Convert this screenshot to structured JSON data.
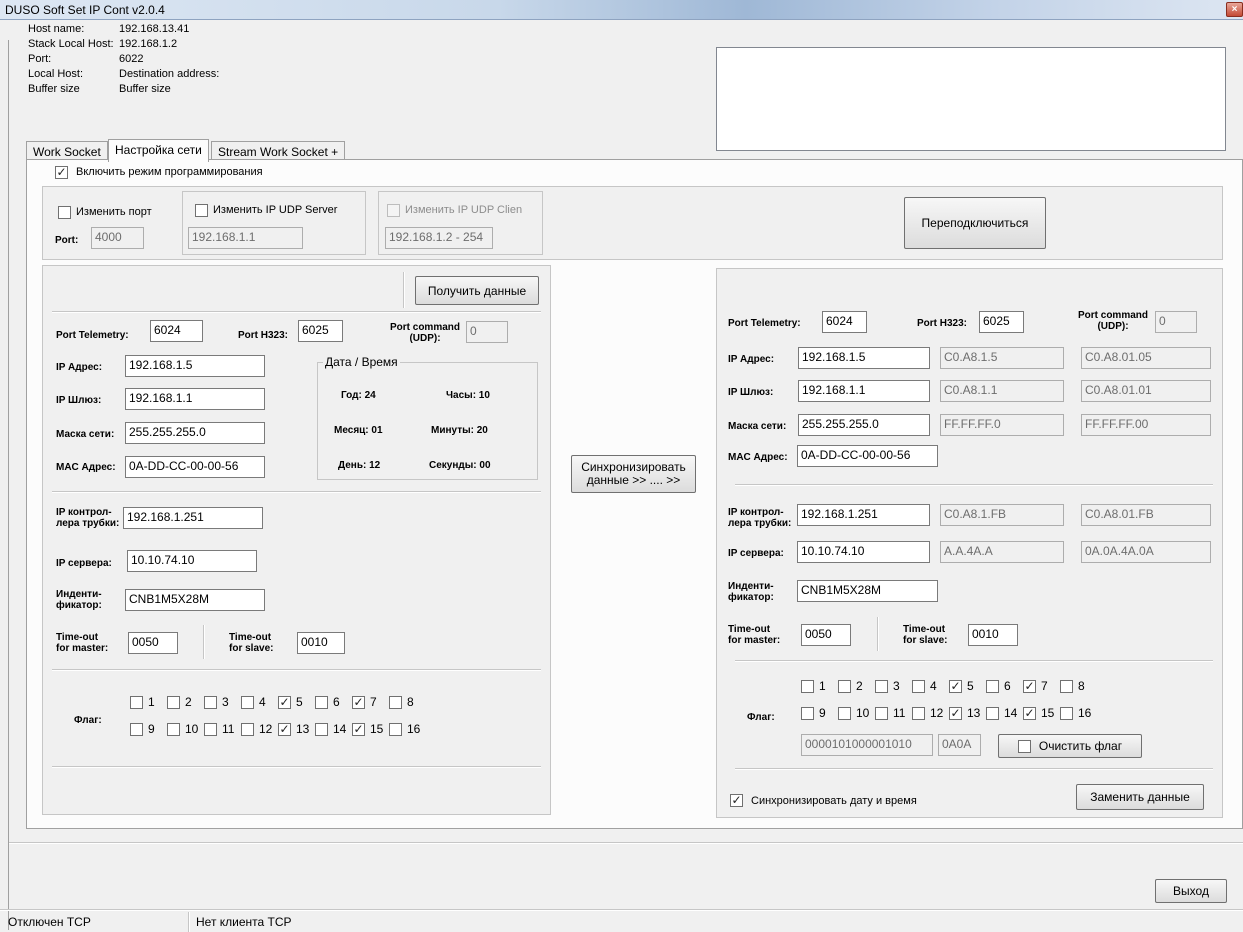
{
  "window": {
    "title": "DUSO Soft Set IP Cont v2.0.4",
    "close_glyph": "×"
  },
  "info": [
    {
      "label": "Host name:",
      "value": "192.168.13.41"
    },
    {
      "label": "Stack Local Host:",
      "value": "192.168.1.2"
    },
    {
      "label": "Port:",
      "value": "6022"
    },
    {
      "label": "Local Host:",
      "value": "Destination address:"
    },
    {
      "label": "Buffer size",
      "value": "Buffer size"
    }
  ],
  "tabs": [
    "Work Socket",
    "Настройка сети",
    "Stream Work Socket +"
  ],
  "enable_programming": "Включить режим программирования",
  "top_group": {
    "change_port": "Изменить порт",
    "port_label": "Port:",
    "port_value": "4000",
    "change_ip_server": "Изменить IP UDP Server",
    "ip_server_value": "192.168.1.1",
    "change_ip_client": "Изменить IP UDP Clien",
    "ip_client_value": "192.168.1.2 - 254",
    "reconnect_button": "Переподключиться"
  },
  "left": {
    "get_data_button": "Получить данные",
    "port_telemetry_label": "Port Telemetry:",
    "port_telemetry": "6024",
    "port_h323_label": "Port H323:",
    "port_h323": "6025",
    "port_command_label_1": "Port command",
    "port_command_label_2": "(UDP):",
    "port_command": "0",
    "ip_label": "IP Адрес:",
    "ip": "192.168.1.5",
    "gateway_label": "IP Шлюз:",
    "gateway": "192.168.1.1",
    "mask_label": "Маска сети:",
    "mask": "255.255.255.0",
    "mac_label": "MAC Адрес:",
    "mac": "0A-DD-CC-00-00-56",
    "datetime": {
      "title": "Дата / Время",
      "year": "Год: 24",
      "hours": "Часы: 10",
      "month": "Месяц: 01",
      "minutes": "Минуты: 20",
      "day": "День: 12",
      "seconds": "Секунды: 00"
    },
    "ip_ctrl_label_1": "IP контрол-",
    "ip_ctrl_label_2": "лера трубки:",
    "ip_ctrl": "192.168.1.251",
    "ip_server_label": "IP сервера:",
    "ip_server": "10.10.74.10",
    "ident_label_1": "Инденти-",
    "ident_label_2": "фикатор:",
    "ident": "CNB1M5X28M",
    "timeout_master_1": "Time-out",
    "timeout_master_2": "for master:",
    "timeout_master": "0050",
    "timeout_slave_1": "Time-out",
    "timeout_slave_2": "for slave:",
    "timeout_slave": "0010",
    "flag_label": "Флаг:"
  },
  "sync_button": {
    "line1": "Синхронизировать",
    "line2": "данные  >> .... >>"
  },
  "right": {
    "port_telemetry_label": "Port Telemetry:",
    "port_telemetry": "6024",
    "port_h323_label": "Port H323:",
    "port_h323": "6025",
    "port_command_label_1": "Port command",
    "port_command_label_2": "(UDP):",
    "port_command": "0",
    "ip_label": "IP Адрес:",
    "ip": "192.168.1.5",
    "ip_hex": "C0.A8.1.5",
    "ip_hex2": "C0.A8.01.05",
    "gateway_label": "IP Шлюз:",
    "gateway": "192.168.1.1",
    "gateway_hex": "C0.A8.1.1",
    "gateway_hex2": "C0.A8.01.01",
    "mask_label": "Маска сети:",
    "mask": "255.255.255.0",
    "mask_hex": "FF.FF.FF.0",
    "mask_hex2": "FF.FF.FF.00",
    "mac_label": "MAC Адрес:",
    "mac": "0A-DD-CC-00-00-56",
    "ip_ctrl_label_1": "IP контрол-",
    "ip_ctrl_label_2": "лера трубки:",
    "ip_ctrl": "192.168.1.251",
    "ip_ctrl_hex": "C0.A8.1.FB",
    "ip_ctrl_hex2": "C0.A8.01.FB",
    "ip_server_label": "IP сервера:",
    "ip_server": "10.10.74.10",
    "ip_server_hex": "A.A.4A.A",
    "ip_server_hex2": "0A.0A.4A.0A",
    "ident_label_1": "Инденти-",
    "ident_label_2": "фикатор:",
    "ident": "CNB1M5X28M",
    "timeout_master_1": "Time-out",
    "timeout_master_2": "for master:",
    "timeout_master": "0050",
    "timeout_slave_1": "Time-out",
    "timeout_slave_2": "for slave:",
    "timeout_slave": "0010",
    "flag_label": "Флаг:",
    "flag_binary": "0000101000001010",
    "flag_hex": "0A0A",
    "clear_flag_button": "Очистить флаг",
    "sync_datetime": "Синхронизировать дату и время",
    "replace_button": "Заменить данные"
  },
  "flags": [
    {
      "label": "1",
      "checked": false
    },
    {
      "label": "2",
      "checked": false
    },
    {
      "label": "3",
      "checked": false
    },
    {
      "label": "4",
      "checked": false
    },
    {
      "label": "5",
      "checked": true
    },
    {
      "label": "6",
      "checked": false
    },
    {
      "label": "7",
      "checked": true
    },
    {
      "label": "8",
      "checked": false
    },
    {
      "label": "9",
      "checked": false
    },
    {
      "label": "10",
      "checked": false
    },
    {
      "label": "11",
      "checked": false
    },
    {
      "label": "12",
      "checked": false
    },
    {
      "label": "13",
      "checked": true
    },
    {
      "label": "14",
      "checked": false
    },
    {
      "label": "15",
      "checked": true
    },
    {
      "label": "16",
      "checked": false
    }
  ],
  "exit_button": "Выход",
  "status": {
    "tcp": "Отключен TCP",
    "client": "Нет клиента TCP"
  },
  "check_glyph": "✓"
}
